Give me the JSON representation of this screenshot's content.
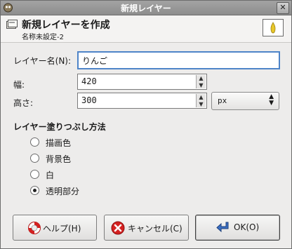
{
  "window": {
    "title": "新規レイヤー"
  },
  "header": {
    "title": "新規レイヤーを作成",
    "subtitle": "名称未設定-2"
  },
  "form": {
    "name_label": "レイヤー名(N):",
    "name_value": "りんご",
    "width_label": "幅:",
    "width_value": "420",
    "height_label": "高さ:",
    "height_value": "300",
    "unit_value": "px"
  },
  "fill": {
    "section_label": "レイヤー塗りつぶし方法",
    "options": [
      {
        "label": "描画色",
        "selected": false
      },
      {
        "label": "背景色",
        "selected": false
      },
      {
        "label": "白",
        "selected": false
      },
      {
        "label": "透明部分",
        "selected": true
      }
    ]
  },
  "buttons": {
    "help": "ヘルプ(H)",
    "cancel": "キャンセル(C)",
    "ok": "OK(O)"
  },
  "colors": {
    "preview_fill": "#e8c72a",
    "cancel_red": "#d42020",
    "ok_blue": "#3a6fc4"
  }
}
